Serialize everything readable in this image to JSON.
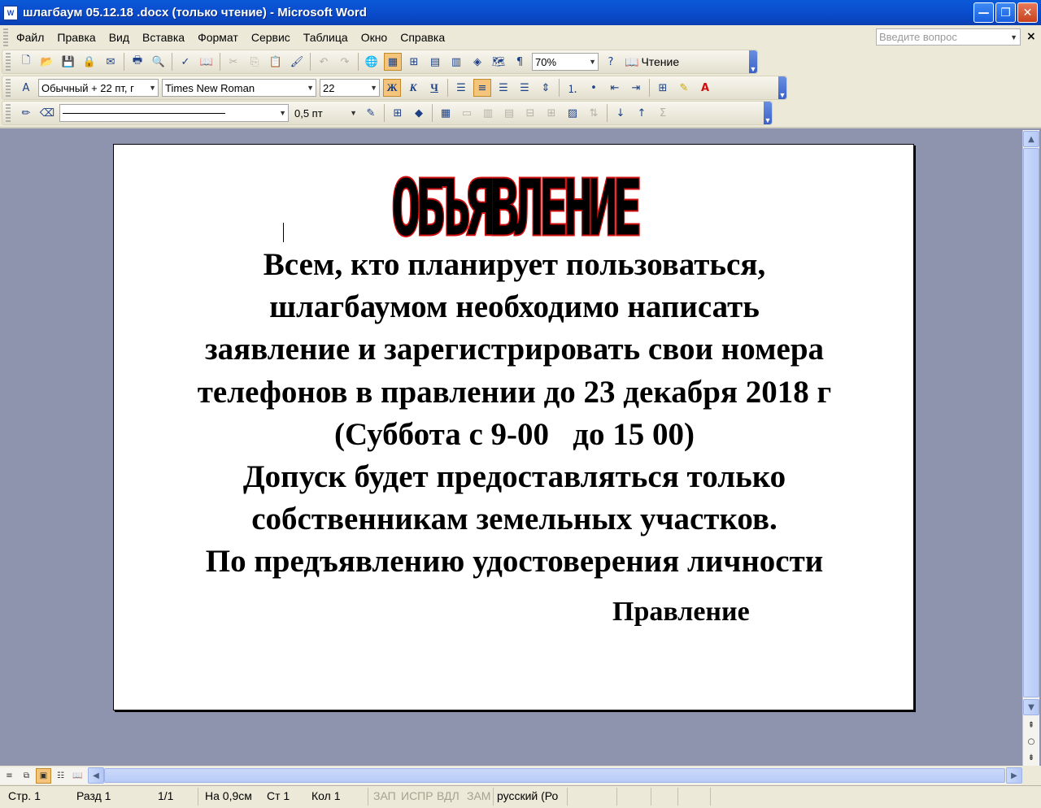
{
  "window": {
    "icon_text": "W",
    "title": "шлагбаум 05.12.18 .docx (только чтение) - Microsoft Word",
    "minimize_glyph": "—",
    "maximize_glyph": "❐",
    "close_glyph": "✕"
  },
  "menu": {
    "items": [
      "Файл",
      "Правка",
      "Вид",
      "Вставка",
      "Формат",
      "Сервис",
      "Таблица",
      "Окно",
      "Справка"
    ],
    "ask_placeholder": "Введите вопрос",
    "doc_close_glyph": "×"
  },
  "toolbar_standard": {
    "zoom": "70%",
    "reading_label": "Чтение"
  },
  "toolbar_formatting": {
    "style": "Обычный + 22 пт, г",
    "font": "Times New Roman",
    "size": "22",
    "bold_glyph": "Ж",
    "italic_glyph": "К",
    "underline_glyph": "Ч",
    "bold_active": true,
    "align_center_active": true
  },
  "toolbar_tables": {
    "line_weight": "0,5 пт"
  },
  "document": {
    "heading": "ОБЪЯВЛЕНИЕ",
    "heading_fill": "#000000",
    "heading_outline": "#d10e0e",
    "lines": [
      "Всем, кто планирует пользоваться,",
      "шлагбаумом необходимо написать",
      "заявление и зарегистрировать свои номера",
      "телефонов в правлении до 23 декабря 2018 г",
      "(Суббота с 9-00   до 15 00)",
      "Допуск будет предоставляться только",
      "собственникам земельных участков.",
      "По предъявлению удостоверения личности"
    ],
    "signature": "Правление"
  },
  "statusbar": {
    "page": "Стр. 1",
    "section": "Разд 1",
    "page_of": "1/1",
    "at": "На 0,9см",
    "line": "Ст 1",
    "col": "Кол 1",
    "rec": "ЗАП",
    "trk": "ИСПР",
    "ext": "ВДЛ",
    "ovr": "ЗАМ",
    "language": "русский (Ро"
  }
}
